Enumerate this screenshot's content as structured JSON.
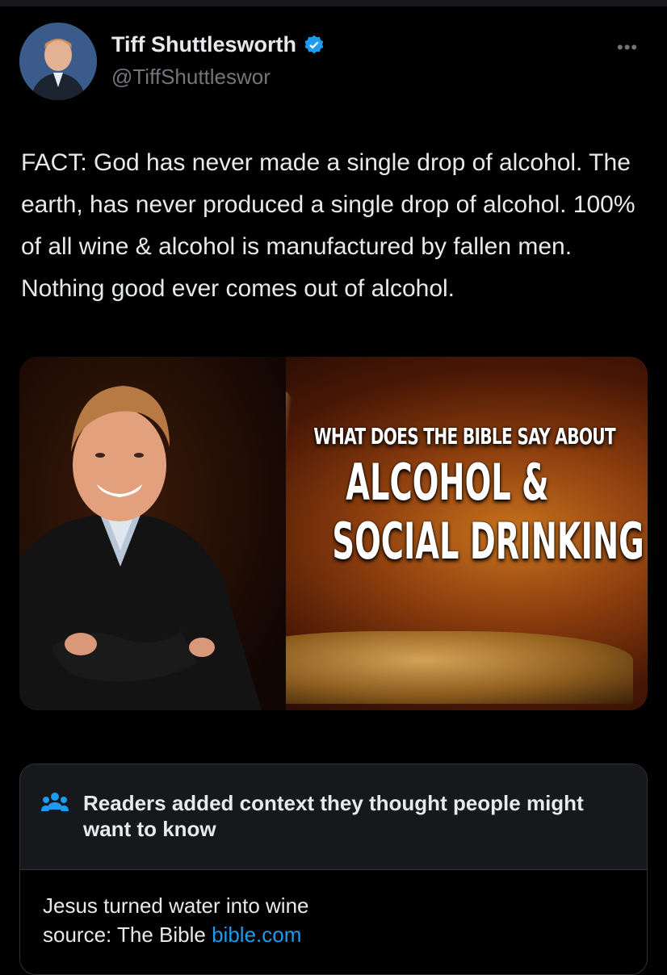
{
  "tweet": {
    "author_name": "Tiff Shuttlesworth",
    "author_handle": "@TiffShuttleswor",
    "more_label": "•••",
    "text": "FACT: God has never made a single drop of alcohol. The earth, has never produced a single drop of alcohol. 100% of all wine & alcohol is manufactured by fallen men. Nothing good ever comes out of alcohol."
  },
  "media": {
    "line1": "WHAT DOES THE BIBLE SAY ABOUT",
    "line2": "ALCOHOL &",
    "line3": "SOCIAL DRINKING"
  },
  "community_note": {
    "title": "Readers added context they thought people might want to know",
    "line1": "Jesus turned water into wine",
    "source_prefix": "source: The Bible ",
    "source_link": "bible.com"
  },
  "colors": {
    "background": "#000000",
    "text": "#e7e9ea",
    "secondary": "#71767b",
    "accent": "#1d9bf0",
    "note_bg": "#16181c"
  },
  "icons": [
    "verified-badge-icon",
    "more-options-icon",
    "community-notes-icon"
  ]
}
